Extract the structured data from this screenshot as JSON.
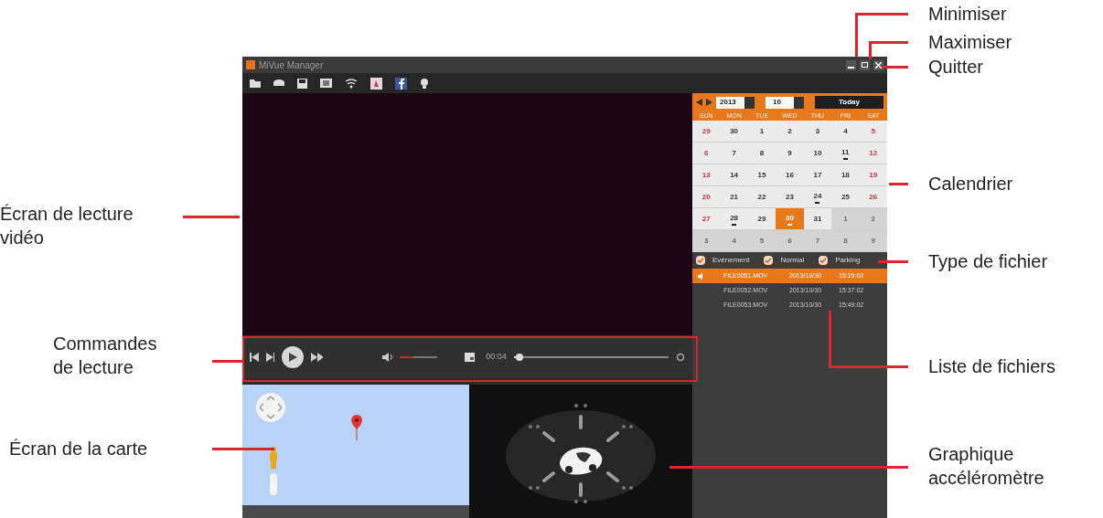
{
  "window": {
    "title": "MiVue Manager"
  },
  "player": {
    "time": "00:04",
    "volume": {
      "level": 0.35
    },
    "progress": {
      "level": 0.02
    }
  },
  "calendar": {
    "year": "2013",
    "month": "10",
    "today_button": "Today",
    "weekdays": [
      "SUN",
      "MON",
      "TUE",
      "WED",
      "THU",
      "FRI",
      "SAT"
    ],
    "days": [
      {
        "label": "29",
        "other_month": false,
        "selected": false,
        "has_files": false
      },
      {
        "label": "30",
        "other_month": false,
        "selected": false,
        "has_files": false
      },
      {
        "label": "1",
        "other_month": false,
        "selected": false,
        "has_files": false
      },
      {
        "label": "2",
        "other_month": false,
        "selected": false,
        "has_files": false
      },
      {
        "label": "3",
        "other_month": false,
        "selected": false,
        "has_files": false
      },
      {
        "label": "4",
        "other_month": false,
        "selected": false,
        "has_files": false
      },
      {
        "label": "5",
        "other_month": false,
        "selected": false,
        "has_files": false
      },
      {
        "label": "6",
        "other_month": false,
        "selected": false,
        "has_files": false
      },
      {
        "label": "7",
        "other_month": false,
        "selected": false,
        "has_files": false
      },
      {
        "label": "8",
        "other_month": false,
        "selected": false,
        "has_files": false
      },
      {
        "label": "9",
        "other_month": false,
        "selected": false,
        "has_files": false
      },
      {
        "label": "10",
        "other_month": false,
        "selected": false,
        "has_files": false
      },
      {
        "label": "11",
        "other_month": false,
        "selected": false,
        "has_files": true
      },
      {
        "label": "12",
        "other_month": false,
        "selected": false,
        "has_files": false
      },
      {
        "label": "13",
        "other_month": false,
        "selected": false,
        "has_files": false
      },
      {
        "label": "14",
        "other_month": false,
        "selected": false,
        "has_files": false
      },
      {
        "label": "15",
        "other_month": false,
        "selected": false,
        "has_files": false
      },
      {
        "label": "16",
        "other_month": false,
        "selected": false,
        "has_files": false
      },
      {
        "label": "17",
        "other_month": false,
        "selected": false,
        "has_files": false
      },
      {
        "label": "18",
        "other_month": false,
        "selected": false,
        "has_files": false
      },
      {
        "label": "19",
        "other_month": false,
        "selected": false,
        "has_files": false
      },
      {
        "label": "20",
        "other_month": false,
        "selected": false,
        "has_files": false
      },
      {
        "label": "21",
        "other_month": false,
        "selected": false,
        "has_files": false
      },
      {
        "label": "22",
        "other_month": false,
        "selected": false,
        "has_files": false
      },
      {
        "label": "23",
        "other_month": false,
        "selected": false,
        "has_files": false
      },
      {
        "label": "24",
        "other_month": false,
        "selected": false,
        "has_files": true
      },
      {
        "label": "25",
        "other_month": false,
        "selected": false,
        "has_files": false
      },
      {
        "label": "26",
        "other_month": false,
        "selected": false,
        "has_files": false
      },
      {
        "label": "27",
        "other_month": false,
        "selected": false,
        "has_files": false
      },
      {
        "label": "28",
        "other_month": false,
        "selected": false,
        "has_files": true
      },
      {
        "label": "29",
        "other_month": false,
        "selected": false,
        "has_files": false
      },
      {
        "label": "30",
        "other_month": false,
        "selected": true,
        "has_files": true
      },
      {
        "label": "31",
        "other_month": false,
        "selected": false,
        "has_files": false
      },
      {
        "label": "1",
        "other_month": true,
        "selected": false,
        "has_files": false
      },
      {
        "label": "2",
        "other_month": true,
        "selected": false,
        "has_files": false
      },
      {
        "label": "3",
        "other_month": true,
        "selected": false,
        "has_files": false
      },
      {
        "label": "4",
        "other_month": true,
        "selected": false,
        "has_files": false
      },
      {
        "label": "5",
        "other_month": true,
        "selected": false,
        "has_files": false
      },
      {
        "label": "6",
        "other_month": true,
        "selected": false,
        "has_files": false
      },
      {
        "label": "7",
        "other_month": true,
        "selected": false,
        "has_files": false
      },
      {
        "label": "8",
        "other_month": true,
        "selected": false,
        "has_files": false
      },
      {
        "label": "9",
        "other_month": true,
        "selected": false,
        "has_files": false
      }
    ]
  },
  "file_types": [
    {
      "label": "Evénement",
      "checked": true
    },
    {
      "label": "Normal",
      "checked": true
    },
    {
      "label": "Parking",
      "checked": true
    }
  ],
  "files": [
    {
      "name": "FILE0051.MOV",
      "date": "2013/10/30",
      "time": "15:29:02",
      "selected": true
    },
    {
      "name": "FILE0052.MOV",
      "date": "2013/10/30",
      "time": "15:37:02",
      "selected": false
    },
    {
      "name": "FILE0053.MOV",
      "date": "2013/10/30",
      "time": "15:49:02",
      "selected": false
    }
  ],
  "annotations": [
    "Minimiser",
    "Maximiser",
    "Quitter",
    "Écran de lecture\nvidéo",
    "Calendrier",
    "Type de fichier",
    "Commandes\nde lecture",
    "Liste de fichiers",
    "Écran de la carte",
    "Graphique\naccéléromètre"
  ]
}
